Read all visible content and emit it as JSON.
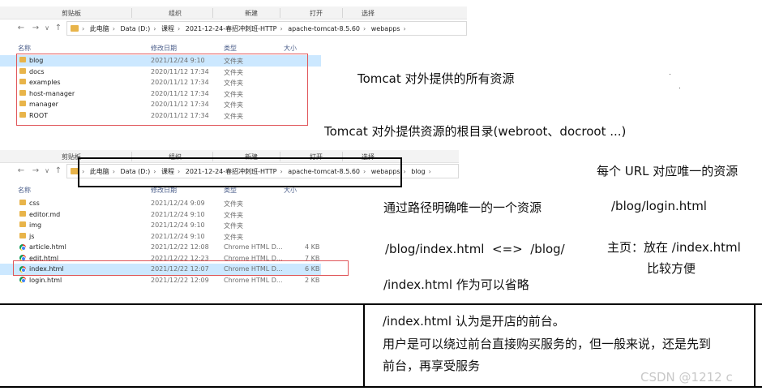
{
  "top_explorer": {
    "ribbon": [
      "剪贴板",
      "组织",
      "新建",
      "打开",
      "选择"
    ],
    "nav": {
      "back": "←",
      "forward": "→",
      "dropdown": "∨",
      "up": "↑"
    },
    "breadcrumb": [
      "此电脑",
      "Data (D:)",
      "课程",
      "2021-12-24-春招冲刺班-HTTP",
      "apache-tomcat-8.5.60",
      "webapps"
    ],
    "columns": {
      "name": "名称",
      "date": "修改日期",
      "type": "类型",
      "size": "大小"
    },
    "rows": [
      {
        "name": "blog",
        "date": "2021/12/24 9:10",
        "type": "文件夹",
        "size": "",
        "icon": "folder-icon"
      },
      {
        "name": "docs",
        "date": "2020/11/12 17:34",
        "type": "文件夹",
        "size": "",
        "icon": "folder-icon"
      },
      {
        "name": "examples",
        "date": "2020/11/12 17:34",
        "type": "文件夹",
        "size": "",
        "icon": "folder-icon"
      },
      {
        "name": "host-manager",
        "date": "2020/11/12 17:34",
        "type": "文件夹",
        "size": "",
        "icon": "folder-icon"
      },
      {
        "name": "manager",
        "date": "2020/11/12 17:34",
        "type": "文件夹",
        "size": "",
        "icon": "folder-icon"
      },
      {
        "name": "ROOT",
        "date": "2020/11/12 17:34",
        "type": "文件夹",
        "size": "",
        "icon": "folder-icon"
      }
    ]
  },
  "bottom_explorer": {
    "ribbon": [
      "剪贴板",
      "组织",
      "新建",
      "打开",
      "选择"
    ],
    "nav": {
      "back": "←",
      "forward": "→",
      "dropdown": "∨",
      "up": "↑"
    },
    "breadcrumb": [
      "此电脑",
      "Data (D:)",
      "课程",
      "2021-12-24-春招冲刺班-HTTP",
      "apache-tomcat-8.5.60",
      "webapps",
      "blog"
    ],
    "columns": {
      "name": "名称",
      "date": "修改日期",
      "type": "类型",
      "size": "大小"
    },
    "rows": [
      {
        "name": "css",
        "date": "2021/12/24 9:09",
        "type": "文件夹",
        "size": "",
        "icon": "folder-icon"
      },
      {
        "name": "editor.md",
        "date": "2021/12/24 9:10",
        "type": "文件夹",
        "size": "",
        "icon": "folder-icon"
      },
      {
        "name": "img",
        "date": "2021/12/24 9:10",
        "type": "文件夹",
        "size": "",
        "icon": "folder-icon"
      },
      {
        "name": "js",
        "date": "2021/12/24 9:10",
        "type": "文件夹",
        "size": "",
        "icon": "folder-icon"
      },
      {
        "name": "article.html",
        "date": "2021/12/22 12:08",
        "type": "Chrome HTML D...",
        "size": "4 KB",
        "icon": "chrome-icon"
      },
      {
        "name": "edit.html",
        "date": "2021/12/22 12:23",
        "type": "Chrome HTML D...",
        "size": "7 KB",
        "icon": "chrome-icon"
      },
      {
        "name": "index.html",
        "date": "2021/12/22 12:07",
        "type": "Chrome HTML D...",
        "size": "6 KB",
        "icon": "chrome-icon"
      },
      {
        "name": "login.html",
        "date": "2021/12/22 12:09",
        "type": "Chrome HTML D...",
        "size": "2 KB",
        "icon": "chrome-icon"
      }
    ]
  },
  "notes": {
    "resources": "Tomcat 对外提供的所有资源",
    "root_dir": "Tomcat 对外提供资源的根目录(webroot、docroot ...)",
    "unique_url": "每个 URL 对应唯一的资源",
    "path_unique": "通过路径明确唯一的一个资源",
    "login_path": "/blog/login.html",
    "index_equiv": "/blog/index.html  <=>  /blog/",
    "home_line1": "主页：放在 /index.html",
    "home_line2": "比较方便",
    "index_omit": "/index.html 作为可以省略",
    "box_line1": "/index.html 认为是开店的前台。",
    "box_line2": "用户是可以绕过前台直接购买服务的，但一般来说，还是先到",
    "box_line3": "前台，再享受服务"
  },
  "watermark": "CSDN @1212 c"
}
